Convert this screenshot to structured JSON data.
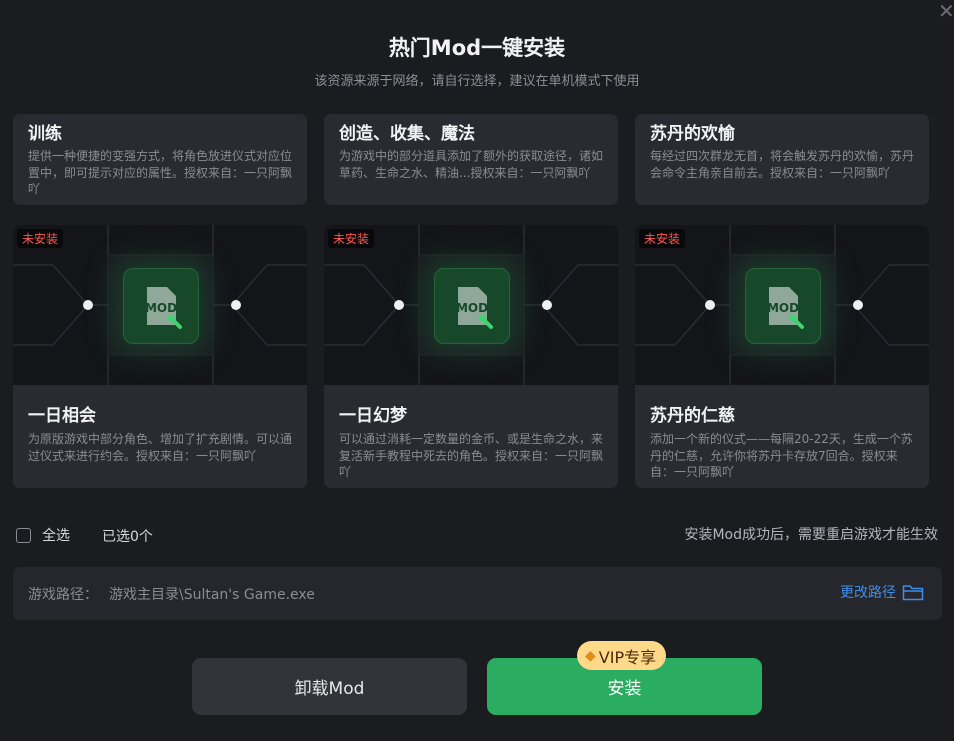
{
  "header": {
    "title": "热门Mod一键安装",
    "subtitle": "该资源来源于网络，请自行选择，建议在单机模式下使用"
  },
  "top_cards": [
    {
      "title": "训练",
      "desc": "提供一种便捷的变强方式，将角色放进仪式对应位置中，即可提示对应的属性。授权来自：一只阿飘吖"
    },
    {
      "title": "创造、收集、魔法",
      "desc": "为游戏中的部分道具添加了额外的获取途径，诸如草药、生命之水、精油...授权来自：一只阿飘吖"
    },
    {
      "title": "苏丹的欢愉",
      "desc": "每经过四次群龙无首，将会触发苏丹的欢愉，苏丹会命令主角亲自前去。授权来自：一只阿飘吖"
    }
  ],
  "cards": [
    {
      "badge": "未安装",
      "icon_label": "MOD",
      "title": "一日相会",
      "desc": "为原版游戏中部分角色、增加了扩充剧情。可以通过仪式来进行约会。授权来自：一只阿飘吖"
    },
    {
      "badge": "未安装",
      "icon_label": "MOD",
      "title": "一日幻梦",
      "desc": "可以通过消耗一定数量的金币、或是生命之水，来复活新手教程中死去的角色。授权来自：一只阿飘吖"
    },
    {
      "badge": "未安装",
      "icon_label": "MOD",
      "title": "苏丹的仁慈",
      "desc": "添加一个新的仪式——每隔20-22天，生成一个苏丹的仁慈，允许你将苏丹卡存放7回合。授权来自：一只阿飘吖"
    }
  ],
  "selection": {
    "select_all": "全选",
    "selected_count": "已选0个"
  },
  "notice": "安装Mod成功后，需要重启游戏才能生效",
  "path": {
    "label": "游戏路径：",
    "value": "游戏主目录\\Sultan's Game.exe",
    "change": "更改路径"
  },
  "buttons": {
    "uninstall": "卸载Mod",
    "install": "安装",
    "vip": "VIP专享"
  },
  "colors": {
    "accent_green": "#2aad60",
    "link_blue": "#3e8ee8",
    "badge_red": "#ff5a52",
    "vip_gold": "#ffd98a"
  },
  "icons": {
    "close": "close-icon",
    "folder": "folder-icon",
    "mod": "mod-file-icon",
    "wrench": "wrench-icon",
    "gem": "gem-icon"
  }
}
